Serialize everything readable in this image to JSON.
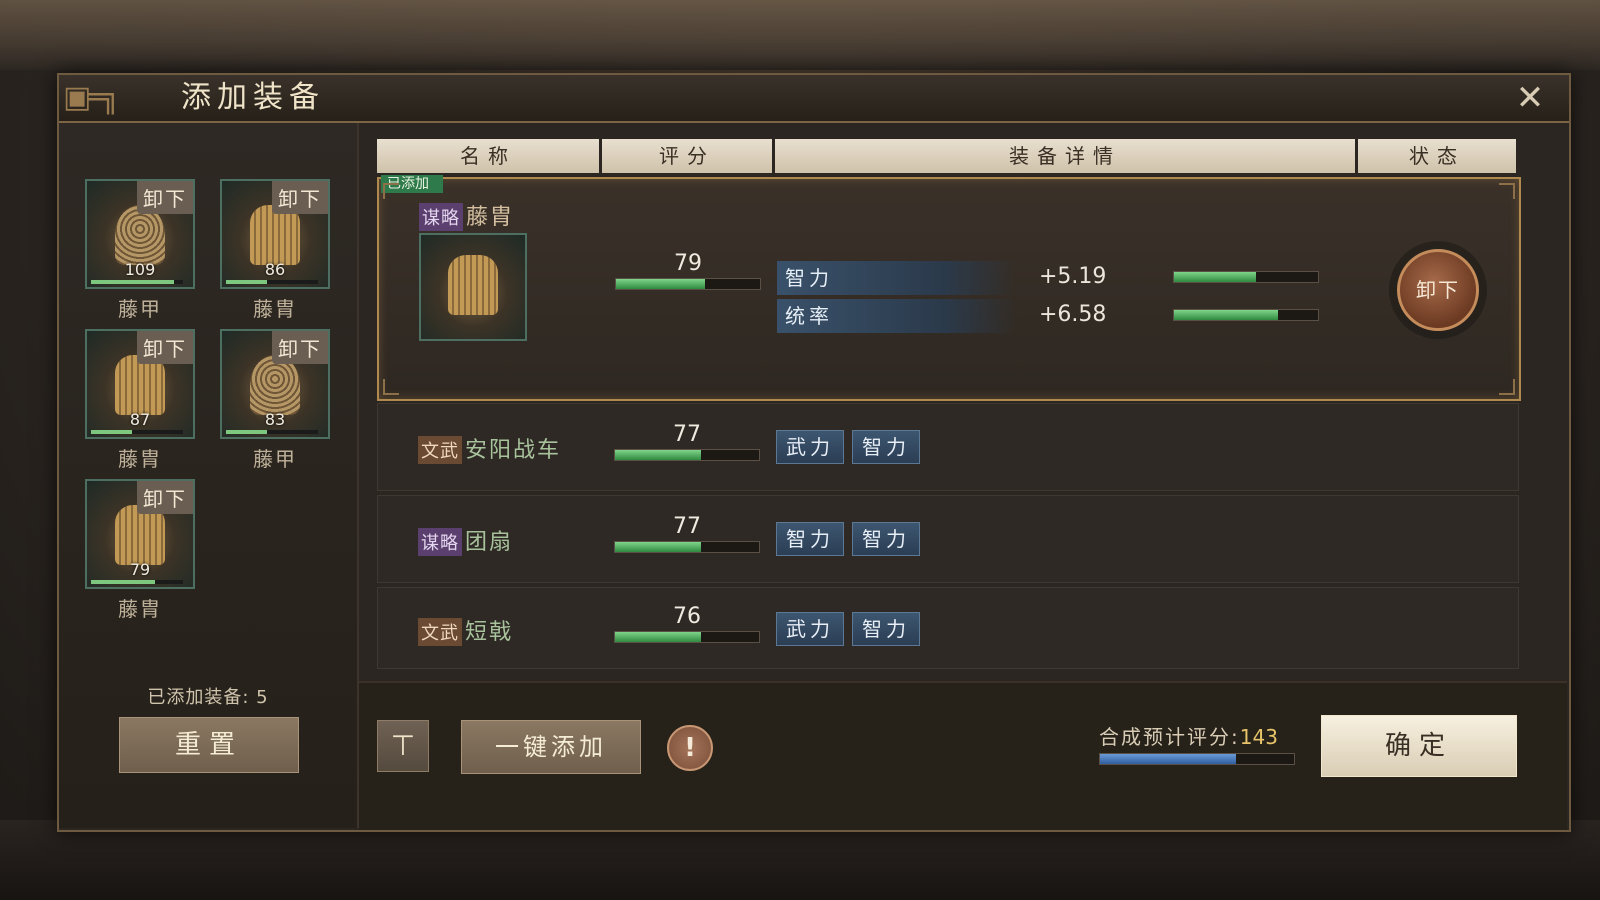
{
  "dialog": {
    "title": "添加装备",
    "close_icon": "close-icon"
  },
  "equipped": {
    "slots": [
      {
        "name": "藤甲",
        "level": "109",
        "tag": "卸下",
        "fill": 0.9,
        "shape": "round"
      },
      {
        "name": "藤胄",
        "level": "86",
        "tag": "卸下",
        "fill": 0.45,
        "shape": "vest"
      },
      {
        "name": "藤胄",
        "level": "87",
        "tag": "卸下",
        "fill": 0.45,
        "shape": "vest"
      },
      {
        "name": "藤甲",
        "level": "83",
        "tag": "卸下",
        "fill": 0.45,
        "shape": "round"
      },
      {
        "name": "藤胄",
        "level": "79",
        "tag": "卸下",
        "fill": 0.7,
        "shape": "vest"
      }
    ],
    "count_label": "已添加装备: 5",
    "reset_label": "重置"
  },
  "table": {
    "headers": [
      "名称",
      "评分",
      "装备详情",
      "状态"
    ],
    "rows": [
      {
        "added_tag": "已添加",
        "type_tag": "谋略",
        "name": "藤胄",
        "score": "79",
        "score_fill": 0.62,
        "attributes": [
          {
            "name": "智力",
            "value": "+5.19",
            "fill": 0.57
          },
          {
            "name": "统率",
            "value": "+6.58",
            "fill": 0.72
          }
        ],
        "action": "卸下"
      },
      {
        "type_tag": "文武",
        "name": "安阳战车",
        "score": "77",
        "score_fill": 0.6,
        "chips": [
          "武力",
          "智力"
        ]
      },
      {
        "type_tag": "谋略",
        "name": "团扇",
        "score": "77",
        "score_fill": 0.6,
        "chips": [
          "智力",
          "智力"
        ]
      },
      {
        "type_tag": "文武",
        "name": "短戟",
        "score": "76",
        "score_fill": 0.6,
        "chips": [
          "武力",
          "智力"
        ]
      }
    ]
  },
  "footer": {
    "filter_icon": "filter-icon",
    "add_all_label": "一键添加",
    "info_label": "!",
    "predict_label": "合成预计评分:",
    "predict_value": "143",
    "predict_fill": 0.7,
    "confirm_label": "确定"
  },
  "colors": {
    "accent_gold": "#b0894f",
    "bar_green": "#2f8a3f",
    "bar_blue": "#2e5e9e",
    "score_highlight": "#e7c46a"
  }
}
